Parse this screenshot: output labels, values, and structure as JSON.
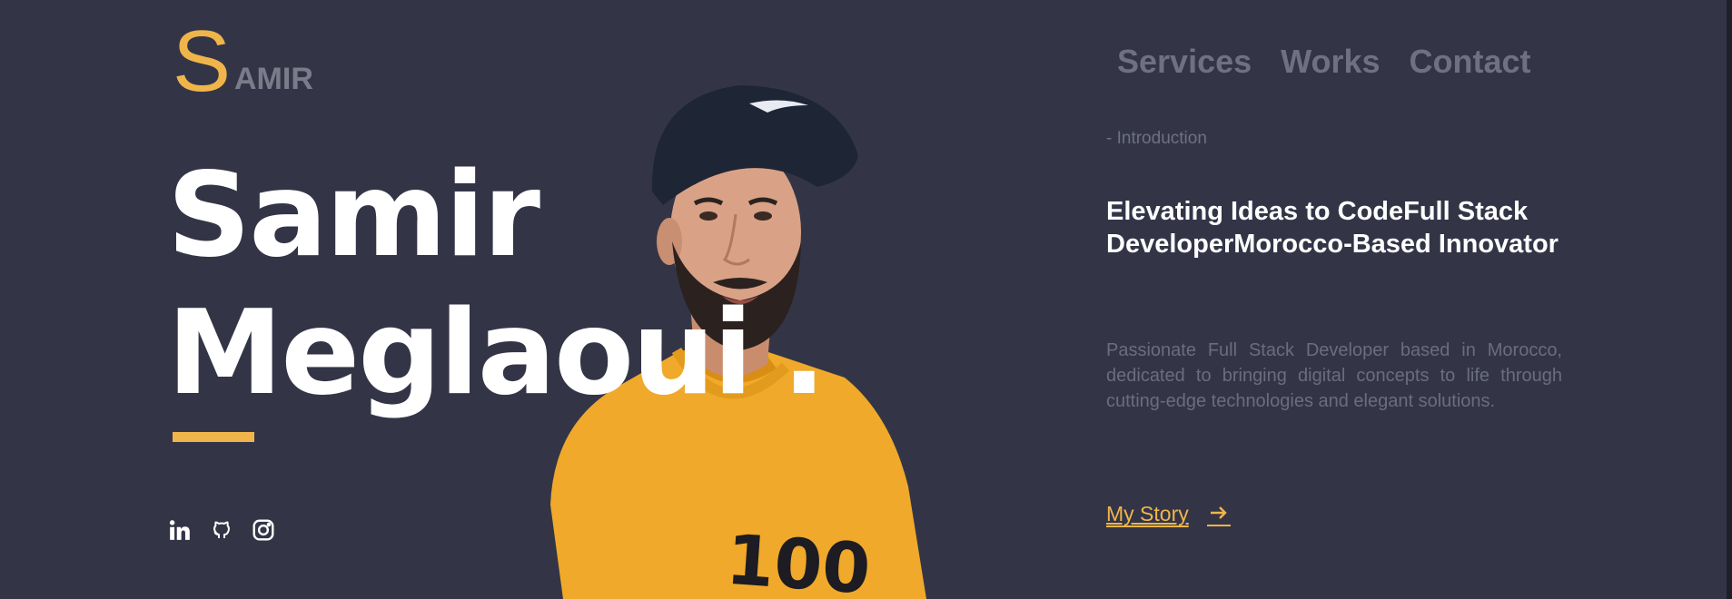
{
  "logo": {
    "initial": "S",
    "rest": "AMIR"
  },
  "nav": {
    "items": [
      "Services",
      "Works",
      "Contact"
    ]
  },
  "hero": {
    "first_name": "Samir",
    "last_name": "Meglaoui",
    "dot": "."
  },
  "social": {
    "icons": [
      "linkedin-icon",
      "github-icon",
      "instagram-icon"
    ]
  },
  "intro": {
    "label": "- Introduction",
    "headline": "Elevating Ideas to CodeFull Stack DeveloperMorocco-Based Innovator",
    "description": "Passionate Full Stack Developer based in Morocco, dedicated to bringing digital concepts to life through cutting-edge technologies and elegant solutions.",
    "cta": "My Story"
  },
  "colors": {
    "background": "#333547",
    "accent": "#f0b54a",
    "muted": "#6f7180",
    "text": "#ffffff"
  }
}
